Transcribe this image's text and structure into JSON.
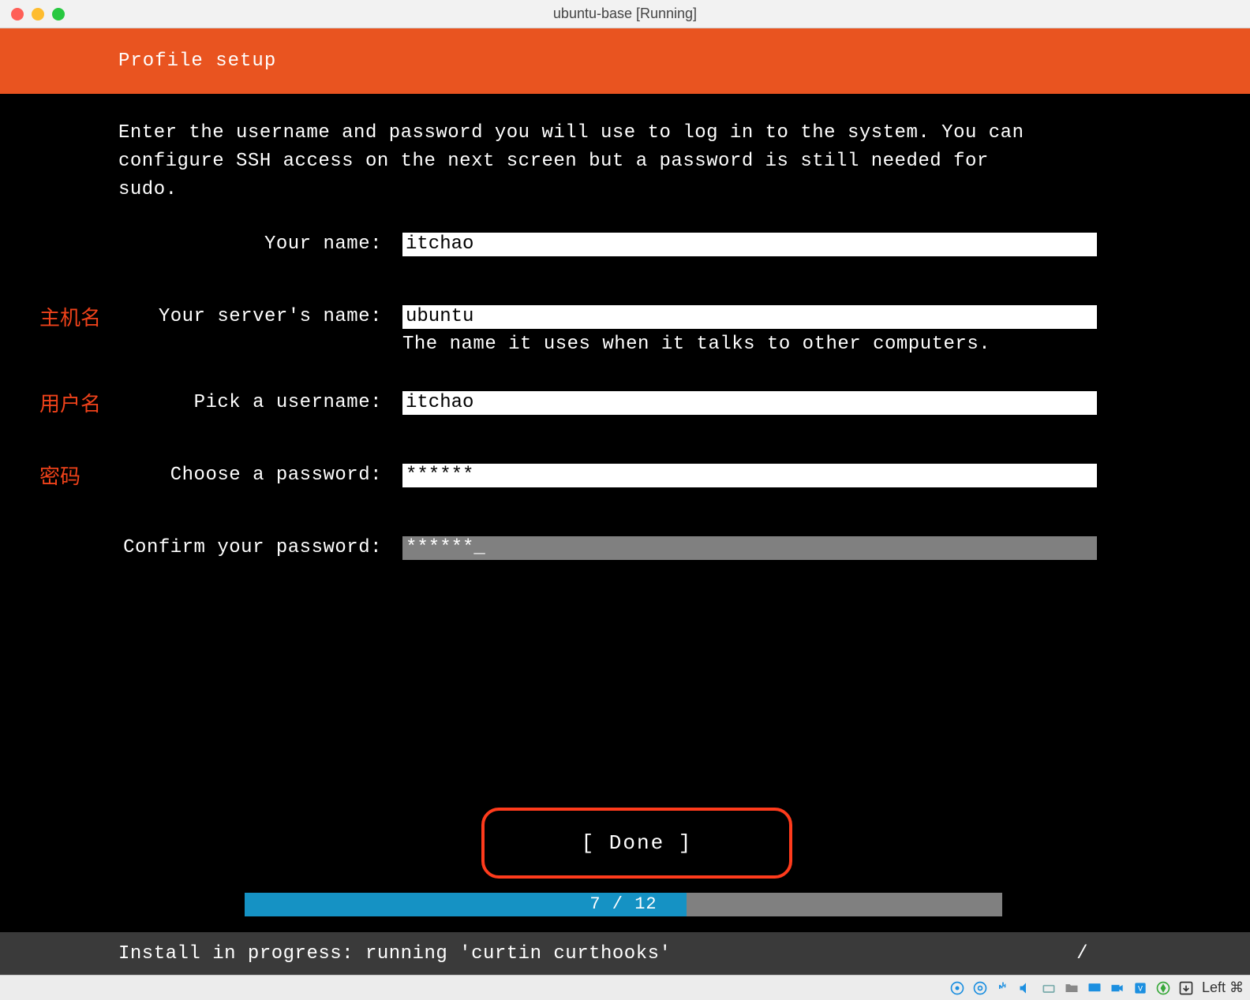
{
  "window": {
    "title": "ubuntu-base [Running]"
  },
  "banner": {
    "title": "Profile setup"
  },
  "instructions": "Enter the username and password you will use to log in to the system. You can\nconfigure SSH access on the next screen but a password is still needed for\nsudo.",
  "annotations": {
    "hostname": "主机名",
    "username": "用户名",
    "password": "密码"
  },
  "form": {
    "name": {
      "label": "Your name:",
      "value": "itchao"
    },
    "server": {
      "label": "Your server's name:",
      "value": "ubuntu",
      "helper": "The name it uses when it talks to other computers."
    },
    "username": {
      "label": "Pick a username:",
      "value": "itchao"
    },
    "password": {
      "label": "Choose a password:",
      "value": "******"
    },
    "confirm": {
      "label": "Confirm your password:",
      "value": "******_"
    }
  },
  "done": {
    "label": "[ Done        ]"
  },
  "progress": {
    "current": 7,
    "total": 12,
    "label": "7 / 12"
  },
  "status": {
    "text": "Install in progress: running 'curtin curthooks'",
    "spinner": "/"
  },
  "vbox": {
    "host_key": "Left ⌘"
  }
}
